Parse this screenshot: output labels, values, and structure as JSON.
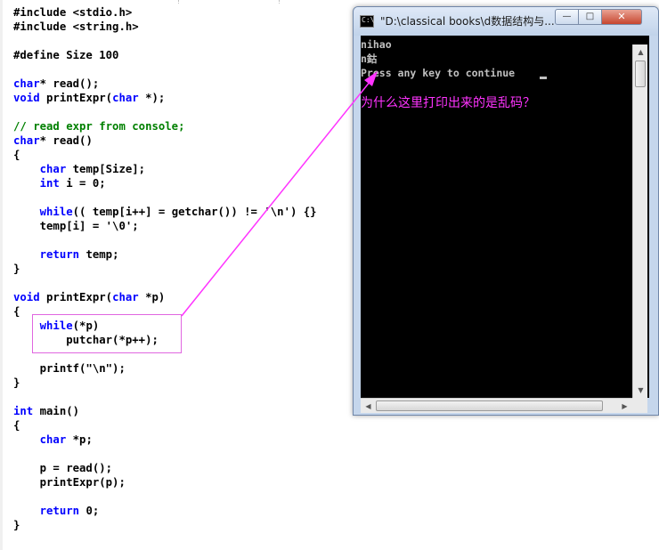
{
  "editor": {
    "lines": [
      [
        {
          "t": "#include <stdio.h>",
          "c": ""
        }
      ],
      [
        {
          "t": "#include <string.h>",
          "c": ""
        }
      ],
      [
        {
          "t": "",
          "c": ""
        }
      ],
      [
        {
          "t": "#define Size 100",
          "c": ""
        }
      ],
      [
        {
          "t": "",
          "c": ""
        }
      ],
      [
        {
          "t": "char",
          "c": "kw"
        },
        {
          "t": "* read();",
          "c": ""
        }
      ],
      [
        {
          "t": "void",
          "c": "kw"
        },
        {
          "t": " printExpr(",
          "c": ""
        },
        {
          "t": "char",
          "c": "kw"
        },
        {
          "t": " *);",
          "c": ""
        }
      ],
      [
        {
          "t": "",
          "c": ""
        }
      ],
      [
        {
          "t": "// read expr from console;",
          "c": "cm"
        }
      ],
      [
        {
          "t": "char",
          "c": "kw"
        },
        {
          "t": "* read()",
          "c": ""
        }
      ],
      [
        {
          "t": "{",
          "c": ""
        }
      ],
      [
        {
          "t": "    ",
          "c": ""
        },
        {
          "t": "char",
          "c": "kw"
        },
        {
          "t": " temp[Size];",
          "c": ""
        }
      ],
      [
        {
          "t": "    ",
          "c": ""
        },
        {
          "t": "int",
          "c": "kw"
        },
        {
          "t": " i = 0;",
          "c": ""
        }
      ],
      [
        {
          "t": "",
          "c": ""
        }
      ],
      [
        {
          "t": "    ",
          "c": ""
        },
        {
          "t": "while",
          "c": "kw"
        },
        {
          "t": "(( temp[i++] = getchar()) != '\\n') {}",
          "c": ""
        }
      ],
      [
        {
          "t": "    temp[i] = '\\0';",
          "c": ""
        }
      ],
      [
        {
          "t": "",
          "c": ""
        }
      ],
      [
        {
          "t": "    ",
          "c": ""
        },
        {
          "t": "return",
          "c": "kw"
        },
        {
          "t": " temp;",
          "c": ""
        }
      ],
      [
        {
          "t": "}",
          "c": ""
        }
      ],
      [
        {
          "t": "",
          "c": ""
        }
      ],
      [
        {
          "t": "void",
          "c": "kw"
        },
        {
          "t": " printExpr(",
          "c": ""
        },
        {
          "t": "char",
          "c": "kw"
        },
        {
          "t": " *p)",
          "c": ""
        }
      ],
      [
        {
          "t": "{",
          "c": ""
        }
      ],
      [
        {
          "t": "    ",
          "c": ""
        },
        {
          "t": "while",
          "c": "kw"
        },
        {
          "t": "(*p)",
          "c": ""
        }
      ],
      [
        {
          "t": "        putchar(*p++);",
          "c": ""
        }
      ],
      [
        {
          "t": "",
          "c": ""
        }
      ],
      [
        {
          "t": "    printf(\"\\n\");",
          "c": ""
        }
      ],
      [
        {
          "t": "}",
          "c": ""
        }
      ],
      [
        {
          "t": "",
          "c": ""
        }
      ],
      [
        {
          "t": "int",
          "c": "kw"
        },
        {
          "t": " main()",
          "c": ""
        }
      ],
      [
        {
          "t": "{",
          "c": ""
        }
      ],
      [
        {
          "t": "    ",
          "c": ""
        },
        {
          "t": "char",
          "c": "kw"
        },
        {
          "t": " *p;",
          "c": ""
        }
      ],
      [
        {
          "t": "",
          "c": ""
        }
      ],
      [
        {
          "t": "    p = read();",
          "c": ""
        }
      ],
      [
        {
          "t": "    printExpr(p);",
          "c": ""
        }
      ],
      [
        {
          "t": "",
          "c": ""
        }
      ],
      [
        {
          "t": "    ",
          "c": ""
        },
        {
          "t": "return",
          "c": "kw"
        },
        {
          "t": " 0;",
          "c": ""
        }
      ],
      [
        {
          "t": "}",
          "c": ""
        }
      ]
    ]
  },
  "console": {
    "title": "\"D:\\classical books\\d数据结构与...",
    "icon_text": "C:\\",
    "buttons": {
      "minimize": "—",
      "maximize": "□",
      "close": "✕"
    },
    "output_lines": [
      "nihao",
      "n鈷",
      "Press any key to continue"
    ],
    "annotation": "为什么这里打印出来的是乱码？"
  },
  "colors": {
    "keyword": "#0000ff",
    "comment": "#008000",
    "annotation": "#ff33ff",
    "console_bg": "#000000",
    "console_fg": "#c0c0c0"
  },
  "icons": {
    "scroll_up": "▲",
    "scroll_down": "▼",
    "scroll_left": "◀",
    "scroll_right": "▶"
  }
}
